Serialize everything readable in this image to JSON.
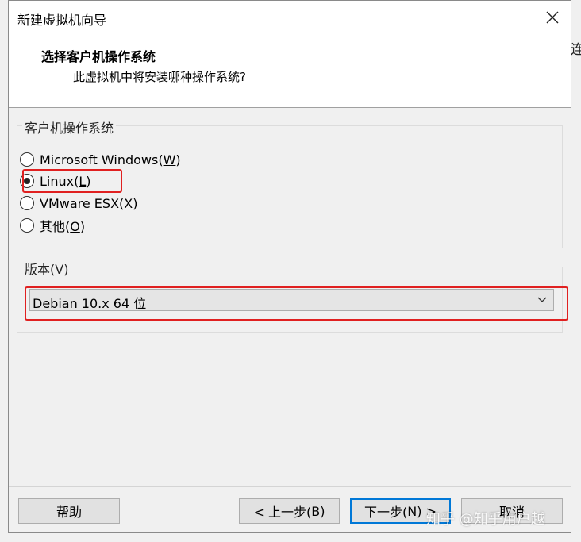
{
  "background": {
    "edge_char": "连"
  },
  "window": {
    "title": "新建虚拟机向导",
    "close_icon": "close-icon"
  },
  "header": {
    "title": "选择客户机操作系统",
    "subtitle": "此虚拟机中将安装哪种操作系统?"
  },
  "guest_os": {
    "group_label": "客户机操作系统",
    "options": [
      {
        "label": "Microsoft Windows(",
        "mnemonic": "W",
        "suffix": ")",
        "checked": false
      },
      {
        "label": "Linux(",
        "mnemonic": "L",
        "suffix": ")",
        "checked": true
      },
      {
        "label": "VMware ESX(",
        "mnemonic": "X",
        "suffix": ")",
        "checked": false
      },
      {
        "label": "其他(",
        "mnemonic": "O",
        "suffix": ")",
        "checked": false
      }
    ]
  },
  "version": {
    "group_label_text": "版本(",
    "group_label_mnemonic": "V",
    "group_label_suffix": ")",
    "selected": "Debian 10.x 64 位"
  },
  "buttons": {
    "help": "帮助",
    "back_text": "< 上一步(",
    "back_mnemonic": "B",
    "back_suffix": ")",
    "next_text": "下一步(",
    "next_mnemonic": "N",
    "next_suffix": ") >",
    "cancel": "取消"
  },
  "watermark": "知乎 @知乎用户越",
  "colors": {
    "highlight_red": "#e02020",
    "focus_blue": "#0078d7"
  }
}
